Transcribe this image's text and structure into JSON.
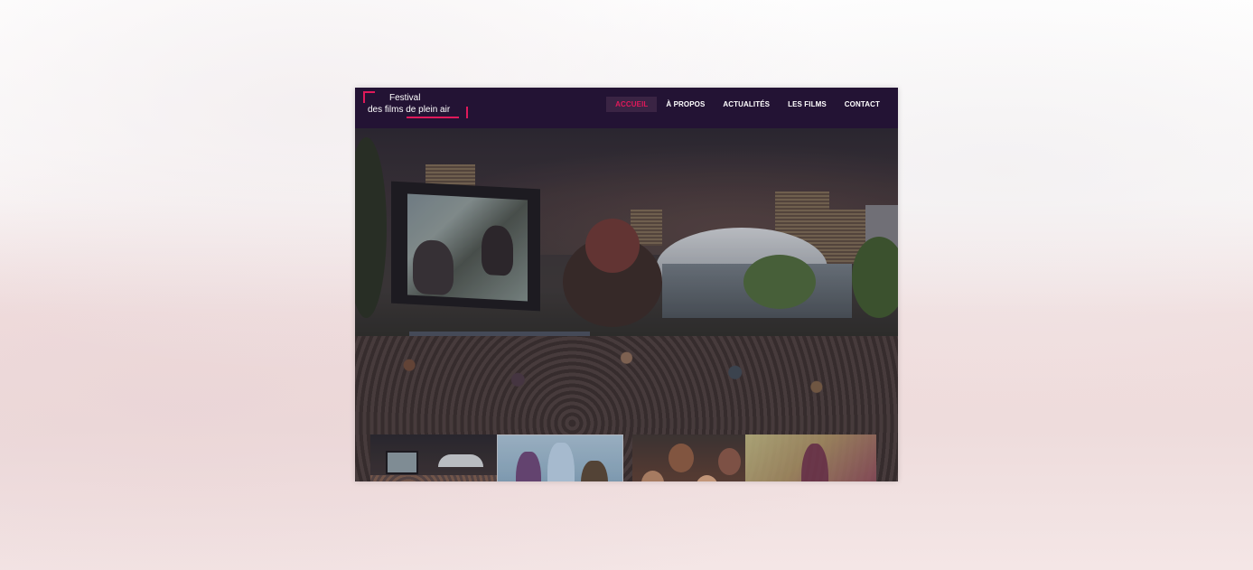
{
  "logo": {
    "line1": "Festival",
    "line2": "des films de plein air"
  },
  "nav": {
    "items": [
      {
        "label": "ACCUEIL",
        "active": true
      },
      {
        "label": "À PROPOS",
        "active": false
      },
      {
        "label": "ACTUALITÉS",
        "active": false
      },
      {
        "label": "LES FILMS",
        "active": false
      },
      {
        "label": "CONTACT",
        "active": false
      }
    ]
  },
  "colors": {
    "accent": "#e0195a",
    "navbar_bg": "#231334"
  }
}
